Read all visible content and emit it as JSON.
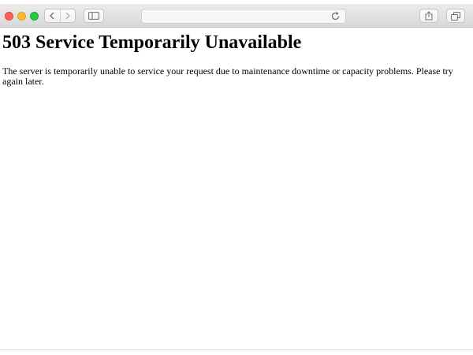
{
  "browser": {
    "window_controls": [
      "close",
      "minimize",
      "maximize"
    ],
    "toolbar": {
      "back_icon": "chevron-left-icon",
      "forward_icon": "chevron-right-icon",
      "sidebar_icon": "sidebar-icon",
      "reload_icon": "reload-icon",
      "share_icon": "share-icon",
      "tabs_icon": "tabs-overview-icon"
    },
    "address_bar": {
      "value": ""
    }
  },
  "page": {
    "heading": "503 Service Temporarily Unavailable",
    "message": "The server is temporarily unable to service your request due to maintenance downtime or capacity problems. Please try again later."
  },
  "colors": {
    "close": "#fd5f57",
    "minimize": "#febb2e",
    "maximize": "#29c840",
    "toolbar": "#dedede",
    "content_background": "#ffffff",
    "text": "#000000"
  }
}
